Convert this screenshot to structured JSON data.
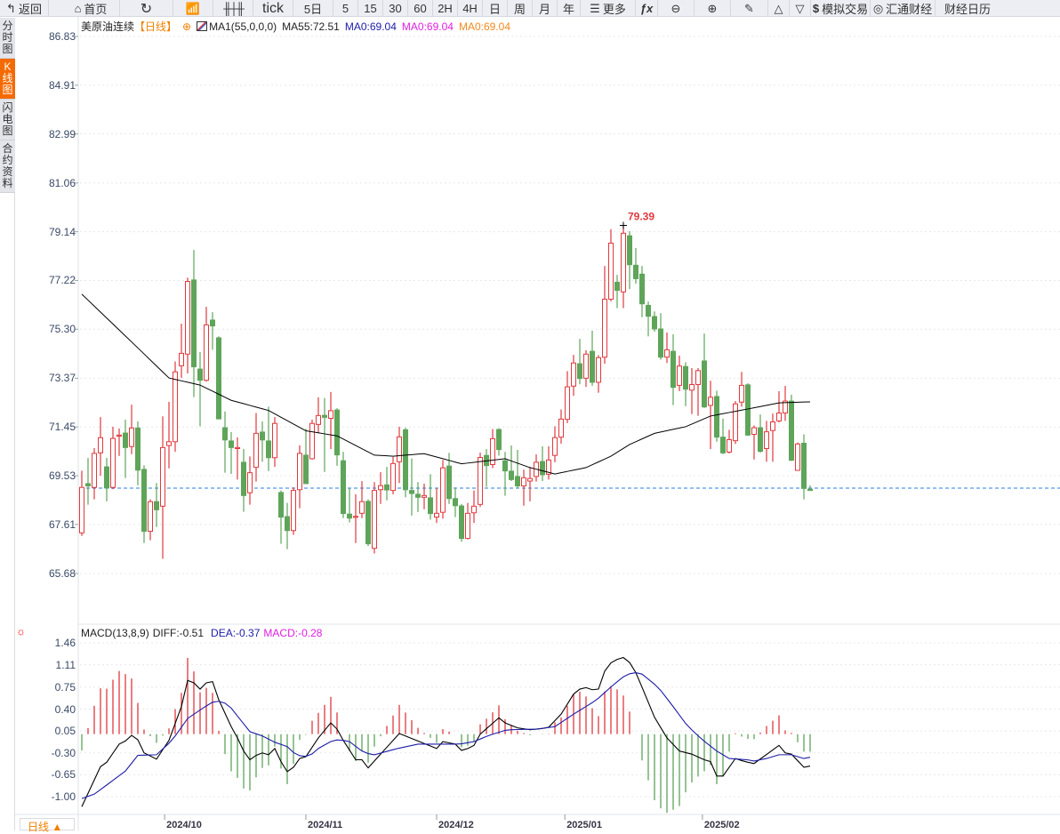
{
  "toolbar": {
    "back": "返回",
    "home": "首页",
    "tick": "tick",
    "five_day": "5日",
    "periods": [
      "5",
      "15",
      "30",
      "60",
      "2H",
      "4H",
      "日",
      "周",
      "月",
      "年"
    ],
    "more": "更多",
    "sim_trade": "模拟交易",
    "huitong": "汇通财经",
    "calendar": "财经日历"
  },
  "left_tabs": [
    "分时图",
    "K线图",
    "闪电图",
    "合约资料"
  ],
  "header": {
    "symbol": "美原油连续",
    "period": "【日线】",
    "ma_name": "MA1(55,0,0,0)",
    "ma55": "MA55:72.51",
    "ma0_a": "MA0:69.04",
    "ma0_b": "MA0:69.04",
    "ma0_c": "MA0:69.04"
  },
  "price_axis": [
    "86.83",
    "84.91",
    "82.99",
    "81.06",
    "79.14",
    "77.22",
    "75.30",
    "73.37",
    "71.45",
    "69.53",
    "67.61",
    "65.68"
  ],
  "high_label": "79.39",
  "macd": {
    "title": "MACD(13,8,9)",
    "diff": "DIFF:-0.51",
    "dea": "DEA:-0.37",
    "macd": "MACD:-0.28",
    "axis": [
      "1.46",
      "1.11",
      "0.75",
      "0.40",
      "0.05",
      "-0.30",
      "-0.65",
      "-1.00"
    ]
  },
  "x_labels": [
    {
      "text": "2024/10",
      "index": 14.3
    },
    {
      "text": "2024/11",
      "index": 37
    },
    {
      "text": "2024/12",
      "index": 58
    },
    {
      "text": "2025/01",
      "index": 78.6
    },
    {
      "text": "2025/02",
      "index": 100.7
    }
  ],
  "period_selector": "日线 ▲",
  "colors": {
    "up": "#e0393e",
    "down": "#5ea55a",
    "ma55": "#000000",
    "dea": "#1c1ca8",
    "last": "#2a7de1",
    "accent": "#f56a00"
  },
  "chart_data": {
    "type": "candlestick",
    "last_price": 69.04,
    "price_range": [
      65.68,
      86.83
    ],
    "candles_ohlc": [
      [
        67.28,
        69.73,
        67.16,
        69.07
      ],
      [
        69.22,
        70.23,
        68.39,
        69.13
      ],
      [
        69.07,
        70.62,
        68.6,
        70.41
      ],
      [
        70.43,
        71.84,
        69.53,
        71.03
      ],
      [
        69.88,
        70.23,
        68.52,
        69.05
      ],
      [
        69.07,
        71.46,
        69.0,
        71.0
      ],
      [
        71.09,
        71.39,
        70.31,
        71.13
      ],
      [
        71.21,
        71.74,
        69.44,
        70.64
      ],
      [
        70.68,
        72.33,
        70.38,
        71.41
      ],
      [
        71.41,
        71.67,
        69.15,
        69.75
      ],
      [
        69.78,
        69.94,
        66.88,
        67.34
      ],
      [
        67.34,
        68.6,
        66.99,
        68.51
      ],
      [
        68.51,
        69.24,
        67.51,
        68.19
      ],
      [
        68.33,
        71.87,
        66.26,
        70.64
      ],
      [
        70.72,
        72.44,
        69.82,
        70.87
      ],
      [
        70.87,
        74.03,
        70.47,
        73.62
      ],
      [
        73.86,
        75.52,
        73.38,
        74.35
      ],
      [
        74.32,
        77.33,
        73.56,
        77.18
      ],
      [
        77.24,
        78.42,
        72.63,
        73.82
      ],
      [
        73.73,
        74.4,
        71.48,
        73.29
      ],
      [
        73.29,
        76.18,
        73.23,
        75.47
      ],
      [
        75.66,
        75.97,
        74.49,
        75.43
      ],
      [
        74.96,
        75.02,
        71.75,
        71.77
      ],
      [
        71.42,
        72.06,
        69.65,
        70.94
      ],
      [
        70.9,
        71.25,
        69.6,
        70.64
      ],
      [
        70.6,
        71.04,
        69.38,
        70.64
      ],
      [
        70.06,
        70.58,
        68.11,
        68.75
      ],
      [
        68.86,
        70.29,
        68.39,
        69.65
      ],
      [
        69.86,
        72.0,
        69.3,
        71.2
      ],
      [
        71.25,
        71.67,
        70.08,
        70.94
      ],
      [
        70.9,
        72.25,
        69.71,
        70.24
      ],
      [
        70.24,
        71.84,
        69.88,
        71.59
      ],
      [
        68.87,
        68.95,
        66.85,
        67.9
      ],
      [
        67.92,
        68.46,
        66.64,
        67.37
      ],
      [
        67.37,
        69.07,
        67.2,
        68.95
      ],
      [
        68.98,
        70.73,
        68.25,
        70.41
      ],
      [
        70.34,
        71.38,
        69.2,
        69.22
      ],
      [
        70.2,
        71.74,
        70.17,
        71.59
      ],
      [
        71.55,
        72.62,
        71.2,
        71.9
      ],
      [
        71.91,
        72.59,
        69.68,
        71.83
      ],
      [
        71.79,
        72.83,
        70.58,
        72.09
      ],
      [
        72.12,
        72.19,
        69.92,
        70.35
      ],
      [
        70.12,
        70.47,
        67.86,
        68.04
      ],
      [
        68.02,
        69.03,
        67.69,
        67.86
      ],
      [
        67.89,
        68.8,
        66.88,
        67.93
      ],
      [
        68.05,
        69.32,
        67.86,
        68.51
      ],
      [
        68.52,
        68.6,
        66.76,
        66.85
      ],
      [
        66.67,
        69.28,
        66.47,
        68.95
      ],
      [
        68.98,
        69.67,
        68.42,
        69.14
      ],
      [
        69.17,
        69.88,
        68.56,
        68.97
      ],
      [
        68.95,
        70.27,
        68.8,
        70.01
      ],
      [
        70.08,
        71.46,
        69.24,
        71.06
      ],
      [
        71.34,
        71.42,
        68.68,
        68.98
      ],
      [
        68.95,
        70.21,
        67.96,
        68.83
      ],
      [
        68.8,
        69.28,
        68.1,
        68.68
      ],
      [
        68.68,
        69.22,
        68.21,
        68.75
      ],
      [
        68.66,
        69.59,
        67.8,
        68.04
      ],
      [
        67.9,
        69.03,
        67.67,
        68.05
      ],
      [
        68.09,
        70.15,
        67.84,
        69.84
      ],
      [
        69.91,
        70.43,
        68.42,
        68.63
      ],
      [
        68.63,
        69.07,
        67.9,
        68.35
      ],
      [
        68.34,
        68.42,
        66.93,
        67.06
      ],
      [
        67.06,
        68.46,
        67.02,
        68.05
      ],
      [
        68.07,
        68.95,
        67.67,
        68.33
      ],
      [
        68.4,
        70.44,
        68.3,
        70.25
      ],
      [
        70.33,
        70.58,
        69.09,
        69.93
      ],
      [
        69.97,
        71.37,
        69.83,
        70.99
      ],
      [
        71.35,
        71.4,
        70.32,
        70.56
      ],
      [
        70.12,
        70.47,
        68.74,
        69.72
      ],
      [
        69.71,
        70.72,
        69.32,
        69.38
      ],
      [
        69.5,
        70.55,
        69.03,
        69.13
      ],
      [
        69.13,
        69.77,
        68.35,
        69.45
      ],
      [
        69.32,
        69.88,
        68.52,
        69.42
      ],
      [
        69.5,
        70.37,
        69.3,
        70.06
      ],
      [
        70.09,
        70.69,
        69.32,
        69.57
      ],
      [
        69.59,
        70.69,
        69.38,
        70.15
      ],
      [
        70.33,
        71.48,
        70.06,
        71.03
      ],
      [
        71.05,
        72.14,
        70.79,
        71.76
      ],
      [
        71.75,
        73.65,
        71.6,
        73.03
      ],
      [
        73.06,
        74.29,
        72.68,
        73.97
      ],
      [
        73.94,
        74.92,
        73.13,
        73.36
      ],
      [
        73.37,
        74.47,
        73.03,
        74.32
      ],
      [
        74.43,
        75.24,
        73.07,
        73.21
      ],
      [
        73.21,
        74.28,
        72.8,
        74.18
      ],
      [
        74.2,
        77.79,
        73.94,
        76.48
      ],
      [
        76.48,
        79.24,
        76.4,
        78.69
      ],
      [
        77.15,
        77.44,
        76.13,
        76.83
      ],
      [
        76.77,
        79.39,
        76.13,
        79.08
      ],
      [
        78.98,
        79.16,
        76.88,
        77.84
      ],
      [
        77.82,
        78.5,
        77.09,
        77.29
      ],
      [
        77.47,
        77.79,
        75.77,
        76.3
      ],
      [
        76.24,
        76.39,
        75.02,
        75.81
      ],
      [
        75.8,
        76.0,
        75.2,
        75.31
      ],
      [
        75.31,
        75.93,
        74.1,
        74.2
      ],
      [
        74.2,
        75.17,
        73.97,
        74.49
      ],
      [
        74.43,
        75.1,
        72.31,
        73.01
      ],
      [
        73.09,
        74.26,
        72.86,
        73.85
      ],
      [
        73.83,
        74.0,
        72.27,
        72.94
      ],
      [
        72.9,
        73.77,
        71.96,
        73.12
      ],
      [
        73.12,
        73.77,
        71.89,
        73.67
      ],
      [
        74.05,
        75.13,
        72.2,
        72.24
      ],
      [
        72.3,
        73.27,
        70.58,
        72.62
      ],
      [
        72.65,
        72.88,
        70.87,
        71.05
      ],
      [
        71.05,
        71.78,
        70.38,
        70.43
      ],
      [
        70.46,
        71.34,
        70.41,
        70.95
      ],
      [
        70.91,
        72.47,
        70.78,
        72.36
      ],
      [
        72.43,
        73.62,
        72.25,
        73.09
      ],
      [
        73.11,
        73.17,
        71.1,
        71.13
      ],
      [
        71.16,
        71.51,
        70.17,
        71.42
      ],
      [
        71.42,
        71.94,
        70.44,
        70.49
      ],
      [
        70.6,
        71.69,
        70.08,
        71.26
      ],
      [
        71.31,
        71.98,
        70.08,
        71.65
      ],
      [
        71.69,
        72.86,
        71.63,
        72.0
      ],
      [
        72.0,
        73.07,
        71.69,
        72.47
      ],
      [
        72.47,
        72.72,
        70.11,
        70.14
      ],
      [
        69.74,
        70.84,
        69.73,
        70.78
      ],
      [
        70.81,
        71.16,
        68.6,
        69.03
      ],
      [
        69.0,
        69.15,
        68.95,
        68.95
      ]
    ],
    "ma55_points": [
      [
        1,
        76.68
      ],
      [
        9,
        74.8
      ],
      [
        15,
        73.38
      ],
      [
        20,
        73.1
      ],
      [
        25,
        72.5
      ],
      [
        31,
        72.1
      ],
      [
        37,
        71.3
      ],
      [
        42,
        71.1
      ],
      [
        48,
        70.34
      ],
      [
        51,
        70.3
      ],
      [
        56,
        70.4
      ],
      [
        62,
        70.0
      ],
      [
        69,
        70.2
      ],
      [
        73,
        69.85
      ],
      [
        77,
        69.6
      ],
      [
        82,
        69.85
      ],
      [
        86,
        70.3
      ],
      [
        89,
        70.76
      ],
      [
        93,
        71.2
      ],
      [
        98,
        71.46
      ],
      [
        102,
        71.88
      ],
      [
        108,
        72.16
      ],
      [
        113,
        72.4
      ],
      [
        118,
        72.44
      ]
    ],
    "macd_range": [
      -1.0,
      1.46
    ],
    "diff_points": [
      [
        1,
        -1.16
      ],
      [
        4,
        -0.52
      ],
      [
        5,
        -0.45
      ],
      [
        7,
        -0.16
      ],
      [
        8,
        -0.11
      ],
      [
        9,
        -0.02
      ],
      [
        10,
        -0.09
      ],
      [
        11,
        -0.3
      ],
      [
        13,
        -0.4
      ],
      [
        15,
        -0.1
      ],
      [
        17,
        0.44
      ],
      [
        18,
        0.86
      ],
      [
        19,
        0.82
      ],
      [
        20,
        0.72
      ],
      [
        21,
        0.82
      ],
      [
        22,
        0.84
      ],
      [
        23,
        0.55
      ],
      [
        25,
        0.12
      ],
      [
        26,
        -0.06
      ],
      [
        27,
        -0.27
      ],
      [
        28,
        -0.41
      ],
      [
        29,
        -0.34
      ],
      [
        30,
        -0.3
      ],
      [
        31,
        -0.33
      ],
      [
        32,
        -0.23
      ],
      [
        33,
        -0.44
      ],
      [
        34,
        -0.6
      ],
      [
        35,
        -0.53
      ],
      [
        36,
        -0.39
      ],
      [
        37,
        -0.36
      ],
      [
        39,
        -0.06
      ],
      [
        41,
        0.18
      ],
      [
        42,
        0.08
      ],
      [
        43,
        -0.1
      ],
      [
        45,
        -0.41
      ],
      [
        46,
        -0.41
      ],
      [
        47,
        -0.54
      ],
      [
        49,
        -0.32
      ],
      [
        52,
        0.01
      ],
      [
        55,
        -0.11
      ],
      [
        58,
        -0.23
      ],
      [
        59,
        -0.12
      ],
      [
        61,
        -0.16
      ],
      [
        62,
        -0.26
      ],
      [
        63,
        -0.23
      ],
      [
        64,
        -0.18
      ],
      [
        65,
        0.0
      ],
      [
        68,
        0.26
      ],
      [
        69,
        0.18
      ],
      [
        71,
        0.1
      ],
      [
        73,
        0.07
      ],
      [
        75,
        0.09
      ],
      [
        76,
        0.11
      ],
      [
        78,
        0.32
      ],
      [
        80,
        0.64
      ],
      [
        81.5,
        0.76
      ],
      [
        83,
        0.71
      ],
      [
        84,
        0.72
      ],
      [
        85.5,
        1.15
      ],
      [
        86.5,
        1.13
      ],
      [
        87.5,
        1.26
      ],
      [
        88.5,
        1.19
      ],
      [
        89.5,
        1.1
      ],
      [
        91,
        0.75
      ],
      [
        93,
        0.27
      ],
      [
        95,
        -0.06
      ],
      [
        97,
        -0.27
      ],
      [
        99,
        -0.32
      ],
      [
        101,
        -0.41
      ],
      [
        102,
        -0.44
      ],
      [
        103,
        -0.67
      ],
      [
        104,
        -0.67
      ],
      [
        106,
        -0.39
      ],
      [
        107.5,
        -0.44
      ],
      [
        109,
        -0.47
      ],
      [
        113,
        -0.18
      ],
      [
        114,
        -0.3
      ],
      [
        115,
        -0.32
      ],
      [
        117,
        -0.53
      ],
      [
        118,
        -0.51
      ]
    ],
    "dea_points": [
      [
        1,
        -1.03
      ],
      [
        3,
        -0.96
      ],
      [
        6,
        -0.74
      ],
      [
        8,
        -0.59
      ],
      [
        10,
        -0.34
      ],
      [
        13,
        -0.33
      ],
      [
        15.5,
        -0.1
      ],
      [
        18,
        0.25
      ],
      [
        20.5,
        0.42
      ],
      [
        22.5,
        0.54
      ],
      [
        24.5,
        0.48
      ],
      [
        26,
        0.29
      ],
      [
        28,
        0.04
      ],
      [
        30,
        -0.03
      ],
      [
        32,
        -0.13
      ],
      [
        34,
        -0.2
      ],
      [
        35.5,
        -0.34
      ],
      [
        37.5,
        -0.36
      ],
      [
        39,
        -0.23
      ],
      [
        41.5,
        -0.09
      ],
      [
        43,
        -0.1
      ],
      [
        44,
        -0.12
      ],
      [
        46.4,
        -0.3
      ],
      [
        48,
        -0.33
      ],
      [
        51.7,
        -0.23
      ],
      [
        55,
        -0.16
      ],
      [
        58,
        -0.16
      ],
      [
        61.7,
        -0.16
      ],
      [
        64,
        -0.12
      ],
      [
        66.4,
        -0.02
      ],
      [
        69.3,
        0.07
      ],
      [
        74,
        0.08
      ],
      [
        77,
        0.12
      ],
      [
        80,
        0.32
      ],
      [
        83.6,
        0.54
      ],
      [
        86.4,
        0.79
      ],
      [
        88.3,
        0.94
      ],
      [
        89.7,
        0.99
      ],
      [
        91,
        0.96
      ],
      [
        93.6,
        0.75
      ],
      [
        96,
        0.44
      ],
      [
        98.3,
        0.13
      ],
      [
        100.7,
        -0.09
      ],
      [
        103,
        -0.27
      ],
      [
        105,
        -0.39
      ],
      [
        107.9,
        -0.41
      ],
      [
        109,
        -0.43
      ],
      [
        111,
        -0.39
      ],
      [
        113,
        -0.33
      ],
      [
        115,
        -0.33
      ],
      [
        117,
        -0.39
      ],
      [
        118,
        -0.37
      ]
    ]
  }
}
